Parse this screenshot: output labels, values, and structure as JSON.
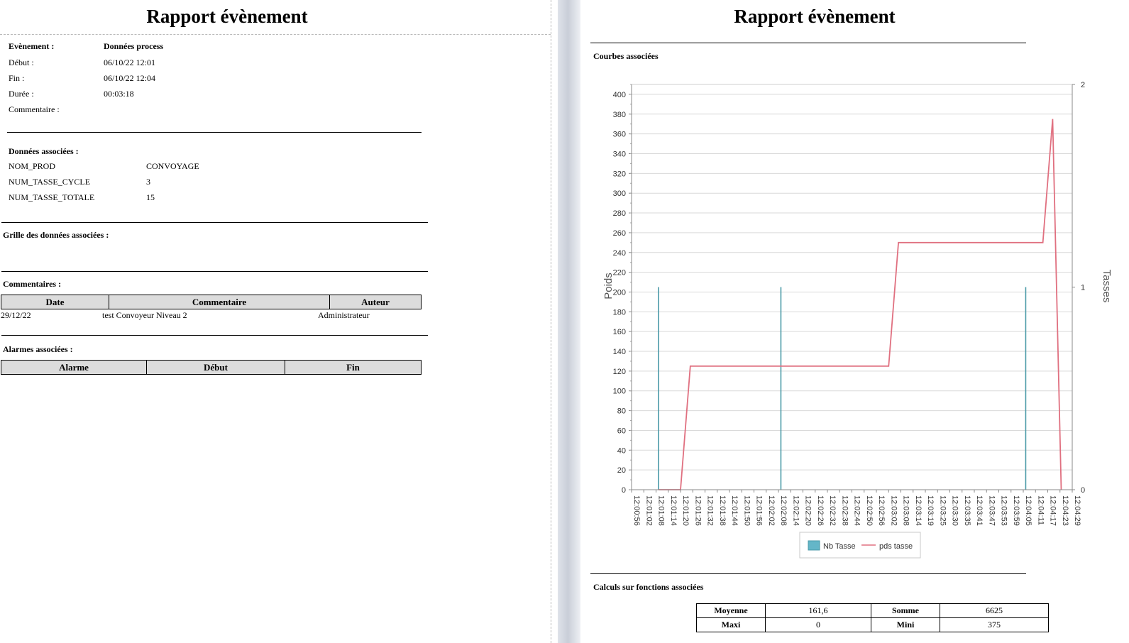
{
  "left": {
    "title": "Rapport évènement",
    "event": {
      "label": "Evènement :",
      "value": "Données process",
      "start_label": "Début :",
      "start_value": "06/10/22 12:01",
      "end_label": "Fin :",
      "end_value": "06/10/22 12:04",
      "duration_label": "Durée :",
      "duration_value": "00:03:18",
      "comment_label": "Commentaire :"
    },
    "associated": {
      "title": "Données associées :",
      "rows": [
        {
          "key": "NOM_PROD",
          "value": "CONVOYAGE"
        },
        {
          "key": "NUM_TASSE_CYCLE",
          "value": "3"
        },
        {
          "key": "NUM_TASSE_TOTALE",
          "value": "15"
        }
      ]
    },
    "grid_title": "Grille des données associées :",
    "comments": {
      "title": "Commentaires :",
      "headers": [
        "Date",
        "Commentaire",
        "Auteur"
      ],
      "rows": [
        {
          "date": "29/12/22",
          "comment": "test Convoyeur Niveau 2",
          "author": "Administrateur"
        }
      ]
    },
    "alarms": {
      "title": "Alarmes associées :",
      "headers": [
        "Alarme",
        "Début",
        "Fin"
      ]
    }
  },
  "right": {
    "title": "Rapport évènement",
    "curves_title": "Courbes associées",
    "calc_title": "Calculs sur fonctions associées",
    "calc": {
      "moyenne_label": "Moyenne",
      "moyenne_value": "161,6",
      "somme_label": "Somme",
      "somme_value": "6625",
      "maxi_label": "Maxi",
      "maxi_value": "0",
      "mini_label": "Mini",
      "mini_value": "375"
    }
  },
  "chart_data": {
    "type": "line",
    "ylabel": "Poids",
    "y2label": "Tasses",
    "ylim": [
      0,
      410
    ],
    "y_ticks": [
      0,
      20,
      40,
      60,
      80,
      100,
      120,
      140,
      160,
      180,
      200,
      220,
      240,
      260,
      280,
      300,
      320,
      340,
      360,
      380,
      400
    ],
    "y2lim": [
      0,
      2
    ],
    "y2_ticks": [
      0,
      1,
      2
    ],
    "x_ticks": [
      "12:00:56",
      "12:01:02",
      "12:01:08",
      "12:01:14",
      "12:01:20",
      "12:01:26",
      "12:01:32",
      "12:01:38",
      "12:01:44",
      "12:01:50",
      "12:01:56",
      "12:02:02",
      "12:02:08",
      "12:02:14",
      "12:02:20",
      "12:02:26",
      "12:02:32",
      "12:02:38",
      "12:02:44",
      "12:02:50",
      "12:02:56",
      "12:03:02",
      "12:03:08",
      "12:03:14",
      "12:03:19",
      "12:03:25",
      "12:03:30",
      "12:03:35",
      "12:03:41",
      "12:03:47",
      "12:03:53",
      "12:03:59",
      "12:04:05",
      "12:04:11",
      "12:04:17",
      "12:04:23",
      "12:04:29"
    ],
    "grid": true,
    "legend": "bottom",
    "series": [
      {
        "name": "Nb Tasse",
        "kind": "bar",
        "axis": "y2",
        "color": "#4a9aa8",
        "points": [
          {
            "x": 2.2,
            "y": 1
          },
          {
            "x": 12.2,
            "y": 1
          },
          {
            "x": 32.2,
            "y": 1
          }
        ]
      },
      {
        "name": "pds tasse",
        "kind": "line",
        "axis": "y",
        "color": "#e07080",
        "points": [
          {
            "x": 2.2,
            "y": 0
          },
          {
            "x": 4.0,
            "y": 0
          },
          {
            "x": 4.8,
            "y": 125
          },
          {
            "x": 21.0,
            "y": 125
          },
          {
            "x": 21.8,
            "y": 250
          },
          {
            "x": 33.6,
            "y": 250
          },
          {
            "x": 34.4,
            "y": 375
          },
          {
            "x": 35.1,
            "y": 0
          }
        ]
      }
    ]
  }
}
